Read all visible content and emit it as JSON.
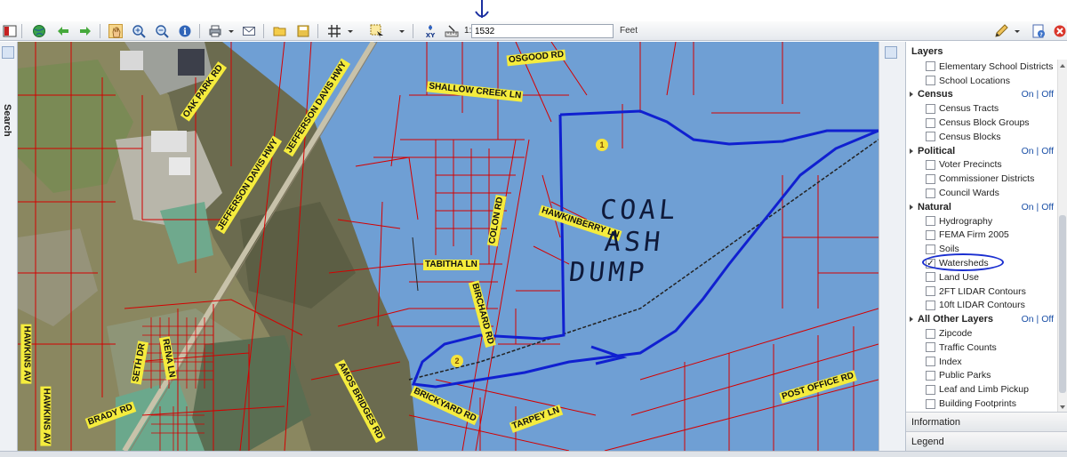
{
  "toolbar": {
    "scale_prefix": "1:",
    "scale_value": "1532",
    "units": "Feet",
    "tools": [
      "layout-icon",
      "globe-icon",
      "back-arrow-icon",
      "forward-arrow-icon",
      "pan-hand-icon",
      "zoom-in-icon",
      "zoom-out-icon",
      "info-icon",
      "print-icon",
      "email-icon",
      "folder-open-icon",
      "save-icon",
      "grid-icon",
      "select-icon",
      "xy-icon",
      "measure-icon"
    ],
    "right_tools": [
      "pencil-icon",
      "help-icon",
      "close-icon"
    ]
  },
  "search": {
    "label": "Search"
  },
  "map": {
    "roads": [
      "OSGOOD RD",
      "SHALLOW CREEK LN",
      "OAK PARK RD",
      "JEFFERSON DAVIS HWY",
      "JEFFERSON DAVIS HWY",
      "COLON RD",
      "HAWKINBERRY LN",
      "TABITHA LN",
      "BIRCHARD RD",
      "BRICKYARD RD",
      "TARPEY LN",
      "POST OFFICE RD",
      "AMOS BRIDGES RD",
      "BRADY RD",
      "HAWKINS AV",
      "HAWKINS AV",
      "SETH DR",
      "RENA LN"
    ],
    "markers": [
      "1",
      "2"
    ],
    "annotation": [
      "COAL",
      "ASH",
      "DUMP"
    ],
    "colors": {
      "water": "#6f9fd4",
      "parcel": "#d40000",
      "watershed": "#1020d0"
    }
  },
  "layers": {
    "title": "Layers",
    "on_label": "On",
    "off_label": "Off",
    "rows": [
      {
        "type": "item",
        "label": "Elementary School Districts",
        "checked": false
      },
      {
        "type": "item",
        "label": "School Locations",
        "checked": false
      },
      {
        "type": "group",
        "label": "Census"
      },
      {
        "type": "item",
        "label": "Census Tracts",
        "checked": false
      },
      {
        "type": "item",
        "label": "Census Block Groups",
        "checked": false
      },
      {
        "type": "item",
        "label": "Census Blocks",
        "checked": false
      },
      {
        "type": "group",
        "label": "Political"
      },
      {
        "type": "item",
        "label": "Voter Precincts",
        "checked": false
      },
      {
        "type": "item",
        "label": "Commissioner Districts",
        "checked": false
      },
      {
        "type": "item",
        "label": "Council Wards",
        "checked": false
      },
      {
        "type": "group",
        "label": "Natural"
      },
      {
        "type": "item",
        "label": "Hydrography",
        "checked": false
      },
      {
        "type": "item",
        "label": "FEMA Firm 2005",
        "checked": false
      },
      {
        "type": "item",
        "label": "Soils",
        "checked": false
      },
      {
        "type": "item",
        "label": "Watersheds",
        "checked": true
      },
      {
        "type": "item",
        "label": "Land Use",
        "checked": false
      },
      {
        "type": "item",
        "label": "2FT LIDAR Contours",
        "checked": false
      },
      {
        "type": "item",
        "label": "10ft LIDAR Contours",
        "checked": false
      },
      {
        "type": "group",
        "label": "All Other Layers"
      },
      {
        "type": "item",
        "label": "Zipcode",
        "checked": false
      },
      {
        "type": "item",
        "label": "Traffic Counts",
        "checked": false
      },
      {
        "type": "item",
        "label": "Index",
        "checked": false
      },
      {
        "type": "item",
        "label": "Public Parks",
        "checked": false
      },
      {
        "type": "item",
        "label": "Leaf and Limb Pickup",
        "checked": false
      },
      {
        "type": "item",
        "label": "Building Footprints",
        "checked": false
      }
    ],
    "sections": [
      "Information",
      "Legend"
    ]
  }
}
